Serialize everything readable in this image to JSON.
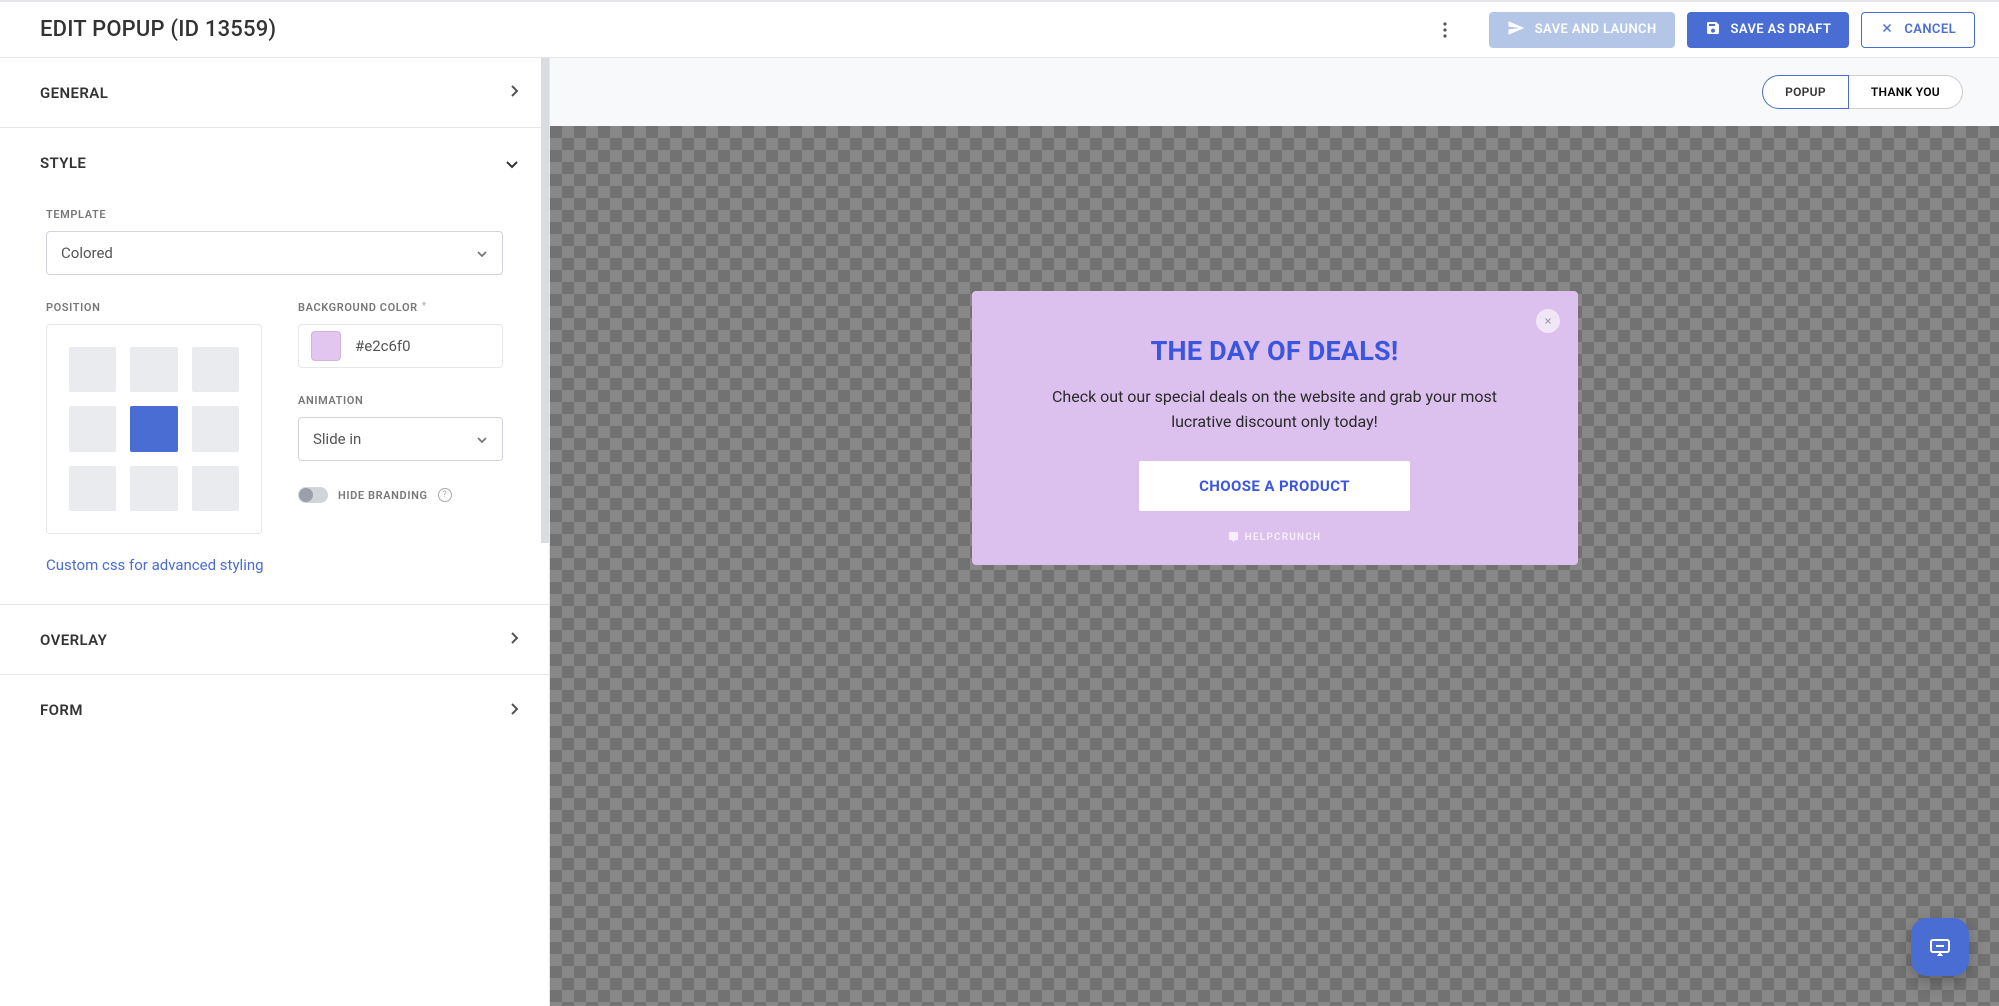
{
  "header": {
    "title": "EDIT POPUP (ID 13559)",
    "save_launch": "SAVE AND LAUNCH",
    "save_draft": "SAVE AS DRAFT",
    "cancel": "CANCEL"
  },
  "sections": {
    "general": "GENERAL",
    "style": "STYLE",
    "overlay": "OVERLAY",
    "form": "FORM"
  },
  "style": {
    "template_label": "TEMPLATE",
    "template_value": "Colored",
    "position_label": "POSITION",
    "position_index": 4,
    "bg_label": "BACKGROUND COLOR",
    "bg_value": "#e2c6f0",
    "anim_label": "ANIMATION",
    "anim_value": "Slide in",
    "hide_branding_label": "HIDE BRANDING",
    "hide_branding_on": false,
    "css_link": "Custom css for advanced styling"
  },
  "preview_tabs": {
    "popup": "POPUP",
    "thank_you": "THANK YOU",
    "active": "popup"
  },
  "popup": {
    "heading": "THE DAY OF DEALS!",
    "body": "Check out our special deals on the website and grab your most lucrative discount only today!",
    "cta": "CHOOSE A PRODUCT",
    "brand": "HELPCRUNCH",
    "bg_color": "#dcc0ed"
  }
}
